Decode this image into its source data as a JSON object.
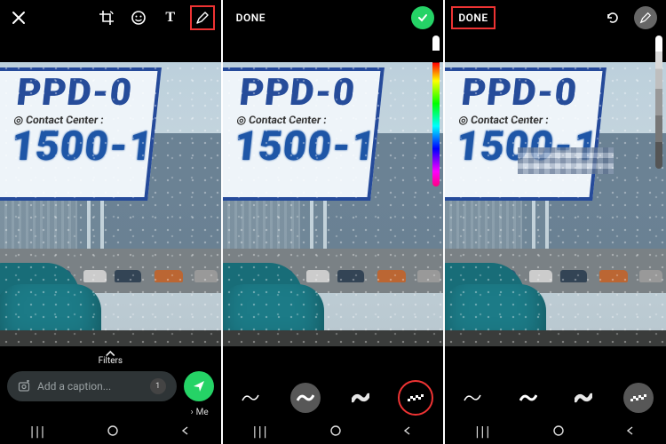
{
  "panel1": {
    "close_icon": "close",
    "crop_icon": "crop-rotate",
    "emoji_icon": "emoji",
    "text_tool": "T",
    "draw_icon": "pen",
    "filters_label": "Filters",
    "caption_placeholder": "Add a caption...",
    "view_once_label": "1",
    "recipient_label": "Me",
    "recipient_chevron": "›",
    "photo": {
      "sign_title": "PPD-0",
      "sign_sub": "◎ Contact Center :",
      "sign_number": "1500-1"
    }
  },
  "panel2": {
    "done_label": "DONE",
    "confirm_icon": "check",
    "brushes": [
      "pen-thin",
      "pen-medium",
      "marker",
      "pixelate"
    ],
    "selected_brush": 3,
    "photo": {
      "sign_title": "PPD-0",
      "sign_sub": "◎ Contact Center :",
      "sign_number": "1500-1"
    }
  },
  "panel3": {
    "done_label": "DONE",
    "undo_icon": "undo",
    "draw_icon": "pen",
    "brushes": [
      "pen-thin",
      "pen-medium",
      "marker",
      "pixelate"
    ],
    "selected_brush": 3,
    "photo": {
      "sign_title": "PPD-0",
      "sign_sub": "◎ Contact Center :",
      "sign_number": "1500-1"
    }
  },
  "nav": {
    "recents": "|||",
    "home": "○",
    "back": "‹"
  }
}
